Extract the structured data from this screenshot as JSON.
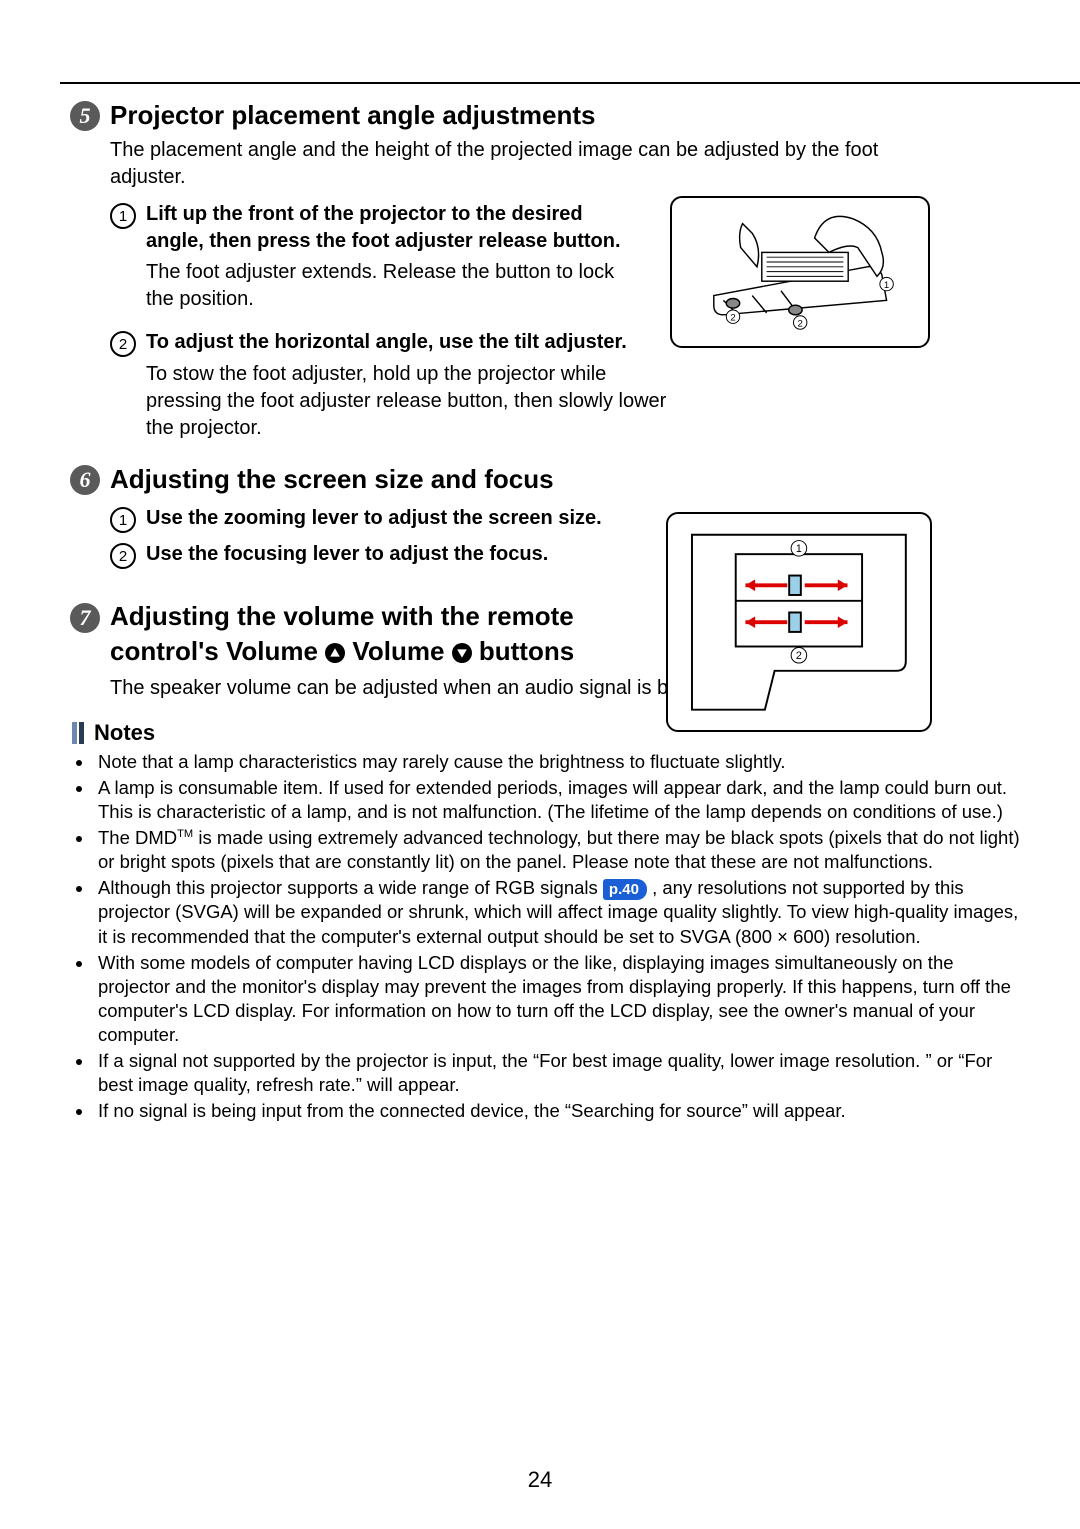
{
  "page_number": "24",
  "sec5": {
    "num": "5",
    "title": "Projector placement angle adjustments",
    "intro": "The placement angle and the height of the projected image can be adjusted by the foot adjuster.",
    "step1_title": "Lift up the front of the projector to the desired angle, then press the foot adjuster release button.",
    "step1_desc": "The foot adjuster extends. Release the button to lock the position.",
    "step2_title": "To adjust the horizontal angle, use the tilt adjuster.",
    "step2_desc": "To stow the foot adjuster, hold up the projector while pressing the foot adjuster release button, then slowly lower the projector."
  },
  "sec6": {
    "num": "6",
    "title": "Adjusting the screen size and focus",
    "step1_title": "Use the zooming lever to adjust the screen size.",
    "step2_title": "Use the focusing lever to adjust the focus."
  },
  "sec7": {
    "num": "7",
    "title_a": "Adjusting the volume with the remote control's Volume ",
    "title_b": " Volume ",
    "title_c": " buttons",
    "body": "The speaker volume can be adjusted when an audio signal is being input."
  },
  "notes_title": "Notes",
  "notes": [
    "Note that a lamp characteristics may rarely cause the brightness to fluctuate slightly.",
    "A lamp is consumable item. If used for extended periods, images will appear dark, and the lamp could burn out.  This is characteristic of a lamp, and is not malfunction. (The lifetime of the lamp depends on conditions of use.)",
    "__DMD__",
    "__RGB__",
    "With some models of computer having LCD displays or the like, displaying images simultaneously on the projector and the monitor's display may prevent the images from displaying properly. If this happens, turn off the computer's LCD display. For information on how to turn off the LCD display, see the owner's manual of your computer.",
    "If a signal not supported by the projector is input, the “For best image quality, lower image resolution. ” or “For best image quality, refresh rate.” will appear.",
    "If no signal is being input from the connected device, the “Searching for source” will appear."
  ],
  "note_dmd_a": "The DMD",
  "note_dmd_b": " is made using extremely advanced technology, but there may be black spots (pixels that do not light) or bright spots (pixels that are constantly lit) on the panel.  Please note that these are not malfunctions.",
  "note_rgb_a": "Although this projector supports a wide range of RGB signals ",
  "note_rgb_ref": "p.40",
  "note_rgb_b": " , any resolutions not supported by this projector (SVGA) will be expanded or shrunk, which will affect image quality slightly. To view high-quality images, it is recommended that the computer's external output should be set to SVGA (800 × 600) resolution.",
  "step_nums": {
    "one": "1",
    "two": "2"
  }
}
